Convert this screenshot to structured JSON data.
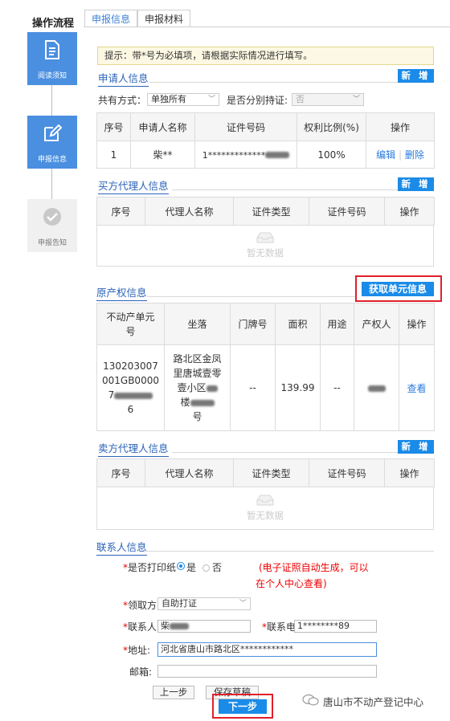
{
  "sidebar": {
    "title": "操作流程",
    "steps": [
      {
        "label": "阅读须知",
        "icon": "document-icon",
        "state": "active"
      },
      {
        "label": "申报信息",
        "icon": "edit-icon",
        "state": "active"
      },
      {
        "label": "申报告知",
        "icon": "check-circle-icon",
        "state": "inactive"
      }
    ]
  },
  "tabs": [
    {
      "label": "申报信息",
      "active": true
    },
    {
      "label": "申报材料",
      "active": false
    }
  ],
  "hint": "提示：带*号为必填项，请根据实际情况进行填写。",
  "applicant": {
    "title": "申请人信息",
    "add_label": "新 增",
    "share_label": "共有方式：",
    "share_value": "单独所有",
    "separate_label": "是否分别持证:",
    "separate_value": "否",
    "headers": [
      "序号",
      "申请人名称",
      "证件号码",
      "权利比例(%)",
      "操作"
    ],
    "rows": [
      {
        "no": "1",
        "name": "柴**",
        "id": "1*************",
        "ratio": "100%",
        "edit": "编辑",
        "delete": "删除"
      }
    ]
  },
  "buyer_agent": {
    "title": "买方代理人信息",
    "add_label": "新 增",
    "headers": [
      "序号",
      "代理人名称",
      "证件类型",
      "证件号码",
      "操作"
    ],
    "empty": "暂无数据"
  },
  "property": {
    "title": "原产权信息",
    "fetch_label": "获取单元信息",
    "headers": [
      "不动产单元号",
      "坐落",
      "门牌号",
      "面积",
      "用途",
      "产权人",
      "操作"
    ],
    "row": {
      "unit_lines": [
        "130203007",
        "001GB0000",
        "7",
        "6"
      ],
      "location_lines": [
        "路北区金凤",
        "里唐城壹零",
        "壹小区",
        "楼",
        "号"
      ],
      "door": "--",
      "area": "139.99",
      "use": "--",
      "view": "查看"
    }
  },
  "seller_agent": {
    "title": "卖方代理人信息",
    "add_label": "新 增",
    "headers": [
      "序号",
      "代理人名称",
      "证件类型",
      "证件号码",
      "操作"
    ],
    "empty": "暂无数据"
  },
  "contact": {
    "title": "联系人信息",
    "print_label": "是否打印纸",
    "opt_yes": "是",
    "opt_no": "否",
    "note_line1": "(电子证照自动生成，可以",
    "note_line2": "在个人中心查看)",
    "pickup_label": "领取方",
    "pickup_value": "自助打证",
    "person_label": "联系人",
    "person_value": "柴",
    "phone_label": "联系电",
    "phone_value": "1********89",
    "address_label": "地址:",
    "address_value": "河北省唐山市路北区************",
    "postcode_label": "邮箱:",
    "postcode_value": ""
  },
  "footer": {
    "prev_label": "上一步",
    "save_label": "保存草稿",
    "next_label": "下一步"
  },
  "watermark": "唐山市不动产登记中心",
  "colors": {
    "accent": "#4a8fe0",
    "button": "#1a8be8",
    "highlight": "#e0202a",
    "note": "#e00000"
  }
}
